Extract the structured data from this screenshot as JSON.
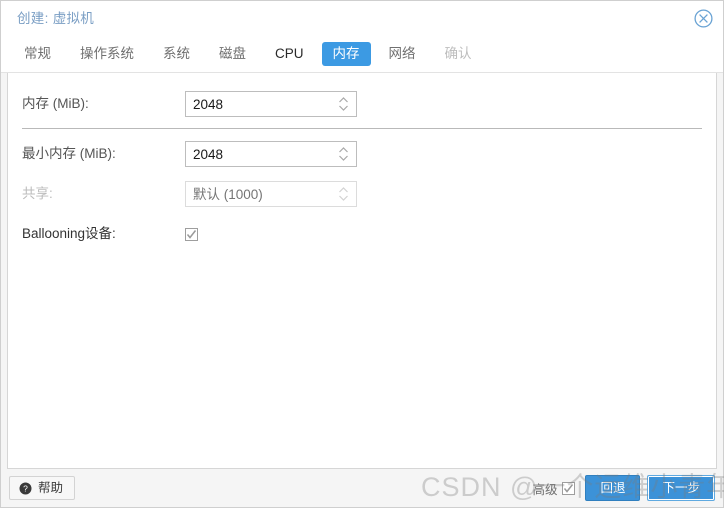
{
  "window": {
    "title": "创建: 虚拟机",
    "close_icon": "close-circle-icon"
  },
  "tabs": [
    {
      "label": "常规",
      "state": "normal"
    },
    {
      "label": "操作系统",
      "state": "normal"
    },
    {
      "label": "系统",
      "state": "normal"
    },
    {
      "label": "磁盘",
      "state": "normal"
    },
    {
      "label": "CPU",
      "state": "strong"
    },
    {
      "label": "内存",
      "state": "active"
    },
    {
      "label": "网络",
      "state": "normal"
    },
    {
      "label": "确认",
      "state": "disabled"
    }
  ],
  "form": {
    "memory": {
      "label": "内存 (MiB):",
      "value": "2048"
    },
    "min_memory": {
      "label": "最小内存 (MiB):",
      "value": "2048"
    },
    "shares": {
      "label": "共享:",
      "value": "",
      "placeholder": "默认 (1000)"
    },
    "ballooning": {
      "label": "Ballooning设备:",
      "checked": true
    }
  },
  "footer": {
    "help_label": "帮助",
    "help_icon": "question-mark-circle-icon",
    "advanced_label": "高级",
    "advanced_checked": true,
    "back_label": "回退",
    "next_label": "下一步"
  },
  "watermark": {
    "text": "CSDN @一个运维小青年"
  },
  "colors": {
    "accent": "#3c9ae3",
    "title_text": "#7a9ec4",
    "button": "#3c92d8"
  }
}
